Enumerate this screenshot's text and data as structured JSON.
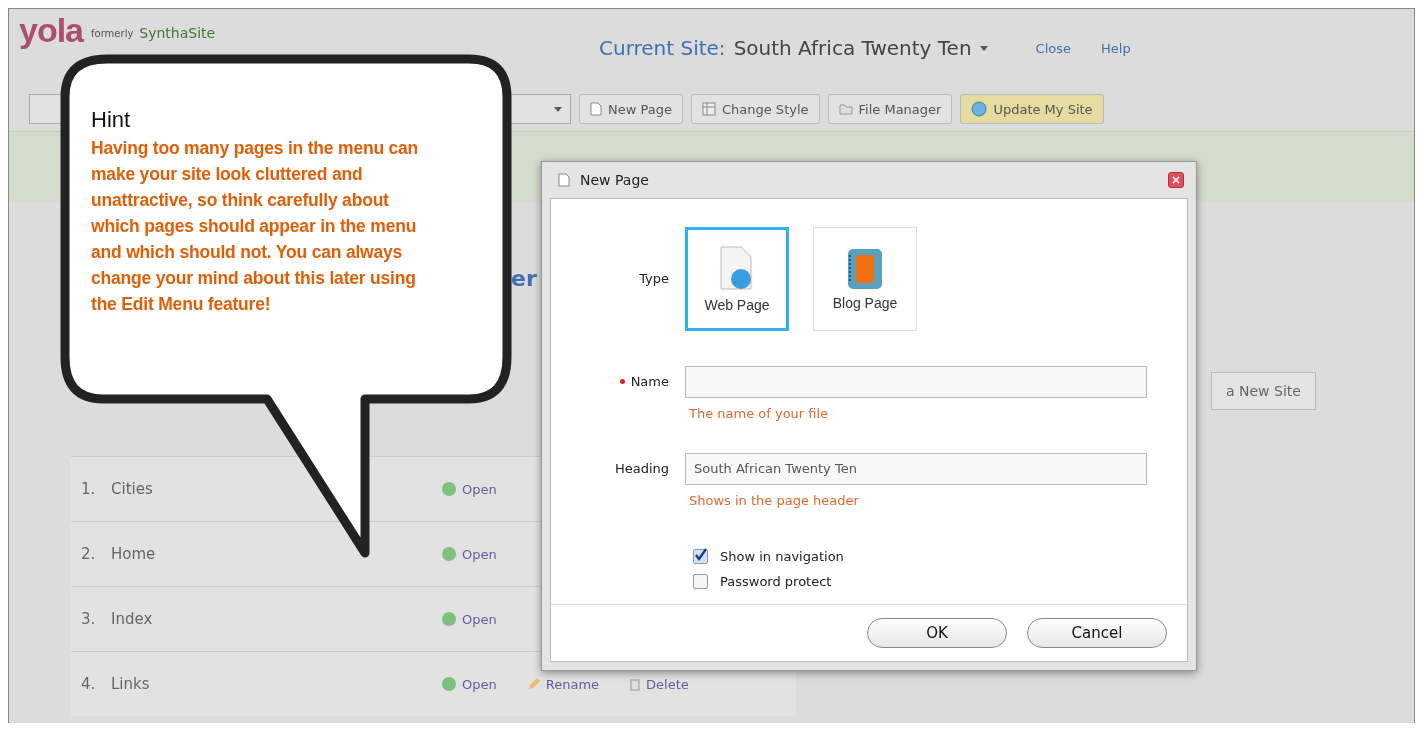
{
  "app": {
    "logo": "yola",
    "formerly": "formerly",
    "former_brand": "SynthaSite",
    "current_site_label": "Current Site:",
    "current_site": "South Africa Twenty Ten",
    "close": "Close",
    "help": "Help"
  },
  "toolbar": [
    {
      "label": "New Page",
      "kind": "page"
    },
    {
      "label": "Change Style",
      "kind": "style"
    },
    {
      "label": "File Manager",
      "kind": "files"
    },
    {
      "label": "Update My Site",
      "kind": "primary"
    }
  ],
  "heading_fragment": "er",
  "pages": [
    {
      "number": "1.",
      "name": "Cities",
      "actions": [
        "Open"
      ]
    },
    {
      "number": "2.",
      "name": "Home",
      "actions": [
        "Open"
      ]
    },
    {
      "number": "3.",
      "name": "Index",
      "actions": [
        "Open"
      ]
    },
    {
      "number": "4.",
      "name": "Links",
      "actions": [
        "Open",
        "Rename",
        "Delete"
      ]
    }
  ],
  "new_site_button": "a New Site",
  "hint": {
    "title": "Hint",
    "text": "Having too many pages in the menu can make your site look cluttered and unattractive, so think carefully about which pages should appear in the menu and which should not.  You can always change your mind about this later using the Edit Menu feature!"
  },
  "dialog": {
    "title": "New Page",
    "type_label": "Type",
    "types": [
      {
        "label": "Web Page",
        "kind": "web",
        "selected": true
      },
      {
        "label": "Blog Page",
        "kind": "blog",
        "selected": false
      }
    ],
    "fields": [
      {
        "label": "Name",
        "required": true,
        "help": "The name of your file"
      },
      {
        "label": "Heading",
        "required": false,
        "value": "South African Twenty Ten",
        "help": "Shows in the page header"
      }
    ],
    "options": [
      {
        "label": "Show in navigation",
        "checked": true
      },
      {
        "label": "Password protect",
        "checked": false
      }
    ],
    "buttons": [
      "OK",
      "Cancel"
    ]
  }
}
